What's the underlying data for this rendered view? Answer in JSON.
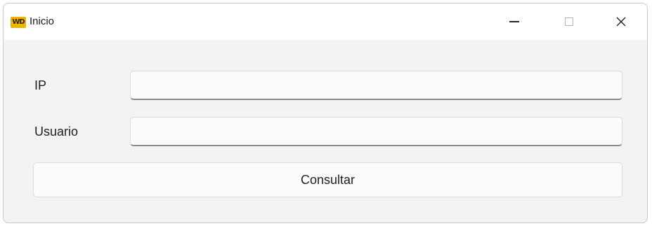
{
  "window": {
    "title": "Inicio",
    "app_icon_text": "WD",
    "app_icon_color": "#f0b400",
    "controls": {
      "minimize_icon": "minimize-icon",
      "maximize_icon": "maximize-icon",
      "close_icon": "close-icon"
    }
  },
  "form": {
    "ip_label": "IP",
    "ip_value": "",
    "user_label": "Usuario",
    "user_value": "",
    "submit_label": "Consultar"
  }
}
